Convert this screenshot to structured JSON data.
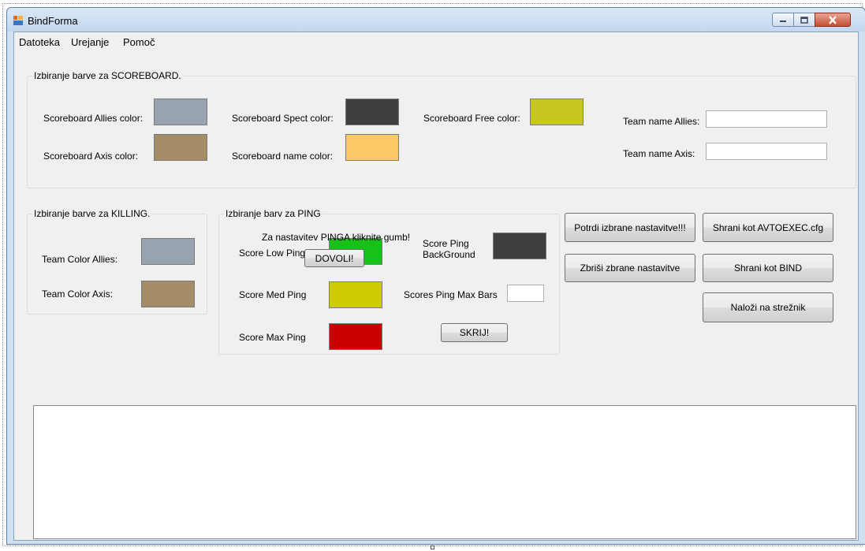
{
  "window": {
    "title": "BindForma"
  },
  "menu": [
    "Datoteka",
    "Urejanje",
    "Pomoč"
  ],
  "scoreboard": {
    "legend": "Izbiranje barve za SCOREBOARD.",
    "allies_label": "Scoreboard Allies color:",
    "axis_label": "Scoreboard Axis color:",
    "spect_label": "Scoreboard Spect color:",
    "name_label": "Scoreboard name color:",
    "free_label": "Scoreboard Free color:",
    "team_allies_label": "Team name Allies:",
    "team_axis_label": "Team name Axis:",
    "team_allies_value": "",
    "team_axis_value": "",
    "colors": {
      "allies": "#97a3ae",
      "axis": "#a48d66",
      "spect": "#3e3e3e",
      "name": "#fdc866",
      "free": "#c7c81f"
    }
  },
  "killing": {
    "legend": "Izbiranje barve za KILLING.",
    "allies_label": "Team Color Allies:",
    "axis_label": "Team Color Axis:",
    "colors": {
      "allies": "#97a3ae",
      "axis": "#a48d66"
    }
  },
  "ping": {
    "legend": "Izbiranje barv za PING",
    "hint": "Za nastavitev PINGA kliknite gumb!",
    "low_label": "Score Low Ping",
    "med_label": "Score Med Ping",
    "max_label": "Score Max Ping",
    "background_label_1": "Score Ping",
    "background_label_2": "BackGround",
    "max_bars_label": "Scores Ping Max Bars",
    "max_bars_value": "",
    "dovoli_button": "DOVOLI!",
    "skrij_button": "SKRIJ!",
    "colors": {
      "low": "#17c117",
      "med": "#cccc00",
      "max": "#cc0000",
      "background": "#3e3e3e"
    }
  },
  "actions": {
    "confirm": "Potrdi izbrane nastavitve!!!",
    "delete": "Zbriši zbrane nastavitve",
    "save_autoexec": "Shrani kot AVTOEXEC.cfg",
    "save_bind": "Shrani kot BIND",
    "upload": "Naloži na strežnik"
  },
  "log": {
    "text": ""
  },
  "icons": {
    "app": "app-window-icon",
    "minimize": "minimize-icon",
    "maximize": "maximize-icon",
    "close": "close-icon"
  }
}
